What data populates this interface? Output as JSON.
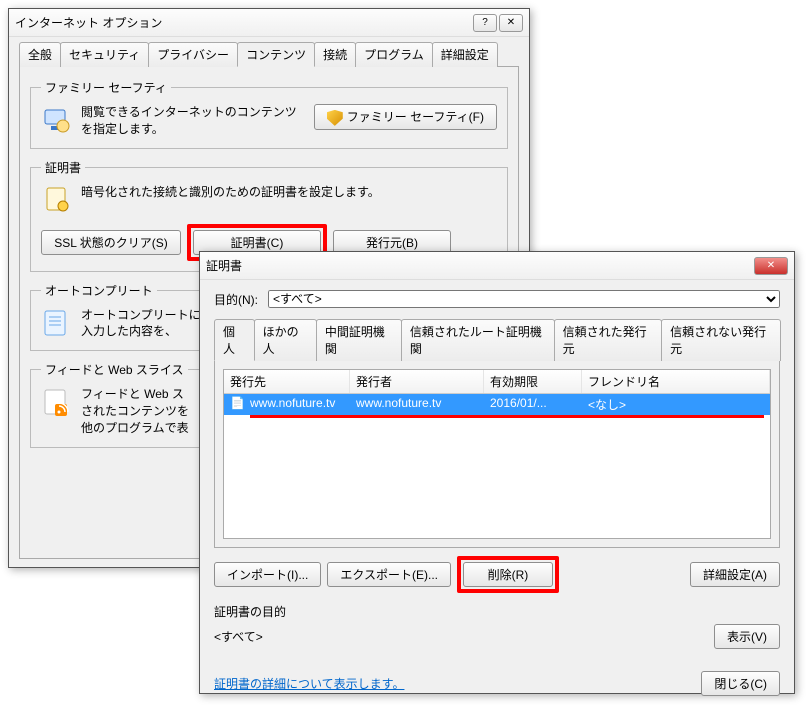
{
  "ie": {
    "title": "インターネット オプション",
    "help_glyph": "?",
    "close_glyph": "✕",
    "tabs": [
      "全般",
      "セキュリティ",
      "プライバシー",
      "コンテンツ",
      "接続",
      "プログラム",
      "詳細設定"
    ],
    "family": {
      "legend": "ファミリー セーフティ",
      "desc": "閲覧できるインターネットのコンテンツを指定します。",
      "btn": "ファミリー セーフティ(F)"
    },
    "cert": {
      "legend": "証明書",
      "desc": "暗号化された接続と識別のための証明書を設定します。",
      "btn_clear": "SSL 状態のクリア(S)",
      "btn_cert": "証明書(C)",
      "btn_issuer": "発行元(B)"
    },
    "autoc": {
      "legend": "オートコンプリート",
      "desc": "オートコンプリートに\n入力した内容を、"
    },
    "feeds": {
      "legend": "フィードと Web スライス",
      "desc": "フィードと Web ス\nされたコンテンツを\n他のプログラムで表"
    }
  },
  "certdlg": {
    "title": "証明書",
    "close_glyph": "✕",
    "purpose_label": "目的(N):",
    "purpose_value": "<すべて>",
    "tabs": [
      "個人",
      "ほかの人",
      "中間証明機関",
      "信頼されたルート証明機関",
      "信頼された発行元",
      "信頼されない発行元"
    ],
    "cols": {
      "issued_to": "発行先",
      "issuer": "発行者",
      "exp": "有効期限",
      "fname": "フレンドリ名"
    },
    "row": {
      "icon": "📄",
      "issued_to": "www.nofuture.tv",
      "issuer": "www.nofuture.tv",
      "exp": "2016/01/...",
      "fname": "<なし>"
    },
    "btn_import": "インポート(I)...",
    "btn_export": "エクスポート(E)...",
    "btn_remove": "削除(R)",
    "btn_adv": "詳細設定(A)",
    "purpose_section": "証明書の目的",
    "purpose_all": "<すべて>",
    "btn_view": "表示(V)",
    "link": "証明書の詳細について表示します。",
    "btn_close": "閉じる(C)"
  }
}
